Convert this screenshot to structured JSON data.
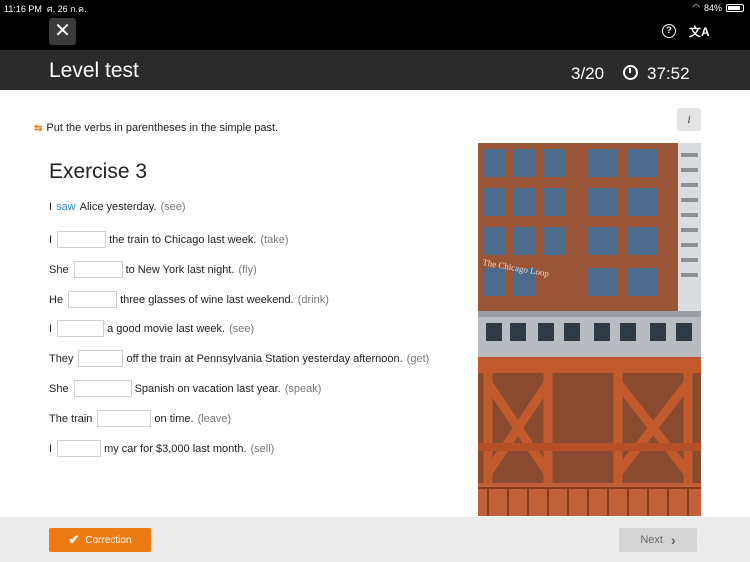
{
  "status": {
    "time": "11:16 PM",
    "date": "ศ. 26 ก.ค.",
    "battery": "84%"
  },
  "header": {
    "title": "Level test",
    "progress": "3/20",
    "timer": "37:52"
  },
  "instruction": "Put the verbs in parentheses in the simple past.",
  "info_label": "i",
  "exercise": {
    "title": "Exercise 3",
    "example": {
      "before": "I",
      "answer": "saw",
      "after": "Alice yesterday.",
      "hint": "(see)"
    },
    "items": [
      {
        "subject": "I",
        "rest": "the train to Chicago last week.",
        "hint": "(take)"
      },
      {
        "subject": "She",
        "rest": "to New York last night.",
        "hint": "(fly)"
      },
      {
        "subject": "He",
        "rest": "three glasses of wine last weekend.",
        "hint": "(drink)"
      },
      {
        "subject": "I",
        "rest": "a good movie last week.",
        "hint": "(see)"
      },
      {
        "subject": "They",
        "rest": "off the train at Pennsylvania Station yesterday afternoon.",
        "hint": "(get)"
      },
      {
        "subject": "She",
        "rest": "Spanish on vacation last year.",
        "hint": "(speak)"
      },
      {
        "subject": "The train",
        "rest": "on time.",
        "hint": "(leave)"
      },
      {
        "subject": "I",
        "rest": "my car for $3,000 last month.",
        "hint": "(sell)"
      }
    ]
  },
  "photo_sign_text": "The Chicago Loop",
  "footer": {
    "correction_label": "Correction",
    "next_label": "Next"
  },
  "icons": {
    "close": "close-icon",
    "help": "help-icon",
    "translate": "translate-icon",
    "clock": "clock-icon",
    "check": "check-icon",
    "next": "chevron-right-icon"
  },
  "colors": {
    "accent": "#ee7a14",
    "answer": "#2a8bd0",
    "header_bg": "#2b2b2b"
  }
}
